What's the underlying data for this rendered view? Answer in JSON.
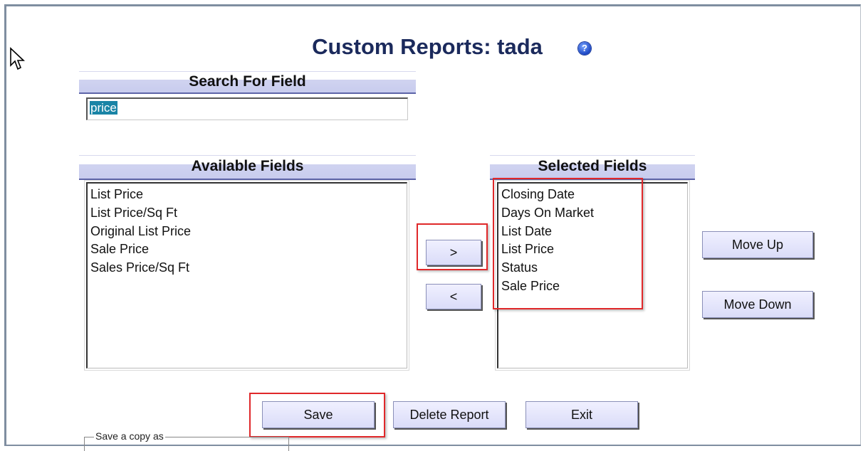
{
  "page": {
    "title": "Custom Reports: tada",
    "help_icon": "question-mark-icon"
  },
  "search": {
    "header": "Search For Field",
    "value": "price"
  },
  "available": {
    "header": "Available Fields",
    "items": [
      "List Price",
      "List Price/Sq Ft",
      "Original List Price",
      "Sale Price",
      "Sales Price/Sq Ft"
    ]
  },
  "selected": {
    "header": "Selected Fields",
    "items": [
      "Closing Date",
      "Days On Market",
      "List Date",
      "List Price",
      "Status",
      "Sale Price"
    ]
  },
  "transfer": {
    "add_label": ">",
    "remove_label": "<"
  },
  "order": {
    "move_up_label": "Move Up",
    "move_down_label": "Move Down"
  },
  "actions": {
    "save_label": "Save",
    "delete_label": "Delete Report",
    "exit_label": "Exit"
  },
  "save_copy": {
    "legend": "Save a copy as"
  },
  "highlight_color": "#e0282a"
}
